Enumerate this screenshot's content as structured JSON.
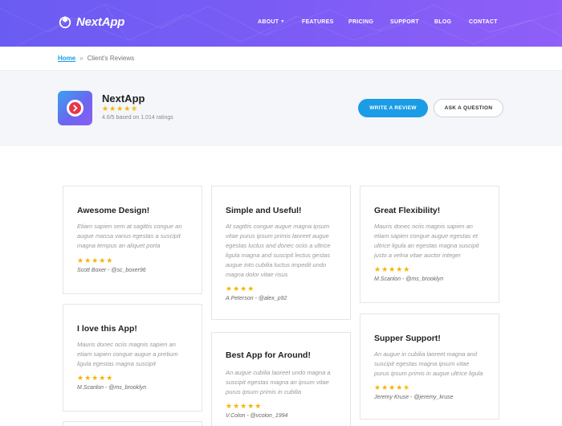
{
  "header": {
    "brand": "NextApp",
    "nav": [
      {
        "label": "ABOUT",
        "has_caret": true
      },
      {
        "label": "FEATURES"
      },
      {
        "label": "PRICING"
      },
      {
        "label": "SUPPORT"
      },
      {
        "label": "BLOG"
      },
      {
        "label": "CONTACT"
      }
    ],
    "caret_icon": "chevron-down-icon",
    "gradient_colors": [
      "#6a5cf2",
      "#8f5ff8"
    ]
  },
  "breadcrumb": {
    "home": "Home",
    "separator": "»",
    "current": "Client's Reviews"
  },
  "app": {
    "name": "NextApp",
    "stars": "★★★★✬",
    "rating_text": "4.6/5 based on 1.014 ratings",
    "rating_value": 4.6,
    "icon": "play-chevron-app-icon",
    "write_review_label": "WRITE A REVIEW",
    "ask_question_label": "ASK A QUESTION",
    "accent_color": "#1b9ce6",
    "star_color": "#f5b400"
  },
  "reviews": [
    {
      "title": "Awesome Design!",
      "lines": [
        "Etiam sapien sem at sagittis congue an",
        "augue massa varius egestas a suscipit",
        "magna tempus an aliquet porta"
      ],
      "stars": "★★★★★",
      "rating": 5,
      "author": "Scott Boxer - @sc_boxer96"
    },
    {
      "title": "Simple and Useful!",
      "lines": [
        "At sagittis congue augue magna ipsum",
        "vitae purus ipsum primis laoreet augue",
        "egestas luctus and donec ociis a ultrice",
        "ligula magna and suscipit lectus gestas",
        "augue into cubilia luctus impedit undo",
        "magna dolor vitae risus"
      ],
      "stars": "★★★★",
      "rating": 4,
      "author": "A.Peterson - @alex_p92"
    },
    {
      "title": "Great Flexibility!",
      "lines": [
        "Mauris donec ociis magnis sapien an",
        "etiam sapien congue augue egestas et",
        "ultrice ligula an egestas magna suscipit",
        "justo a velna vitae auctor integer"
      ],
      "stars": "★★★★★",
      "rating": 5,
      "author": "M.Scanlon - @ms_brooklyn"
    },
    {
      "title": "I love this App!",
      "lines": [
        "Mauris donec ociis magnis sapien an",
        "etiam sapien congue augue a pretium",
        "ligula egestas magna suscipit"
      ],
      "stars": "★★★★★",
      "rating": 5,
      "author": "M.Scanlon - @ms_brooklyn"
    },
    {
      "title": "Best App for Around!",
      "lines": [
        "An augue cubilia laoreet undo magna a",
        "suscipit egestas magna an ipsum vitae",
        "purus ipsum primis in cubilia"
      ],
      "stars": "★★★★★",
      "rating": 5,
      "author": "V.Colon - @vcolon_1994"
    },
    {
      "title": "Supper Support!",
      "lines": [
        "An augue in cubilia laoreet magna and",
        "suscipit egestas magna ipsum vitae",
        "purus ipsum primis in augue ultrice ligula"
      ],
      "stars": "★★★★✬",
      "rating": 4.5,
      "author": "Jeremy Kruse - @jeremy_kruse"
    }
  ]
}
